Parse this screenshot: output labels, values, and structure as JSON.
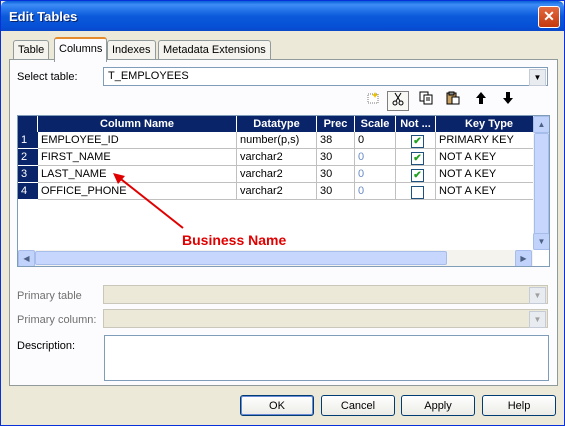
{
  "window": {
    "title": "Edit Tables",
    "close": "✕"
  },
  "tabs": [
    {
      "label": "Table"
    },
    {
      "label": "Columns"
    },
    {
      "label": "Indexes"
    },
    {
      "label": "Metadata Extensions"
    }
  ],
  "select_table": {
    "label": "Select table:",
    "value": "T_EMPLOYEES"
  },
  "toolbar_icons": [
    "new-row-icon",
    "cut-icon",
    "copy-icon",
    "paste-icon",
    "move-up-icon",
    "move-down-icon"
  ],
  "grid": {
    "headers": [
      "Column Name",
      "Datatype",
      "Prec",
      "Scale",
      "Not ...",
      "Key Type"
    ],
    "rows": [
      {
        "num": "1",
        "name": "EMPLOYEE_ID",
        "datatype": "number(p,s)",
        "prec": "38",
        "scale": "0",
        "not_null": true,
        "key": "PRIMARY KEY"
      },
      {
        "num": "2",
        "name": "FIRST_NAME",
        "datatype": "varchar2",
        "prec": "30",
        "scale": "0",
        "not_null": true,
        "key": "NOT A KEY"
      },
      {
        "num": "3",
        "name": "LAST_NAME",
        "datatype": "varchar2",
        "prec": "30",
        "scale": "0",
        "not_null": true,
        "key": "NOT A KEY"
      },
      {
        "num": "4",
        "name": "OFFICE_PHONE",
        "datatype": "varchar2",
        "prec": "30",
        "scale": "0",
        "not_null": false,
        "key": "NOT A KEY"
      }
    ]
  },
  "annotation": {
    "text": "Business Name",
    "color": "#E00000"
  },
  "primary_table": {
    "label": "Primary table",
    "value": ""
  },
  "primary_column": {
    "label": "Primary column:",
    "value": ""
  },
  "description": {
    "label": "Description:",
    "value": ""
  },
  "buttons": {
    "ok": "OK",
    "cancel": "Cancel",
    "apply": "Apply",
    "help": "Help"
  },
  "colors": {
    "title_bar": "#0550D6",
    "grid_header": "#0A246A",
    "check": "#21A121"
  }
}
